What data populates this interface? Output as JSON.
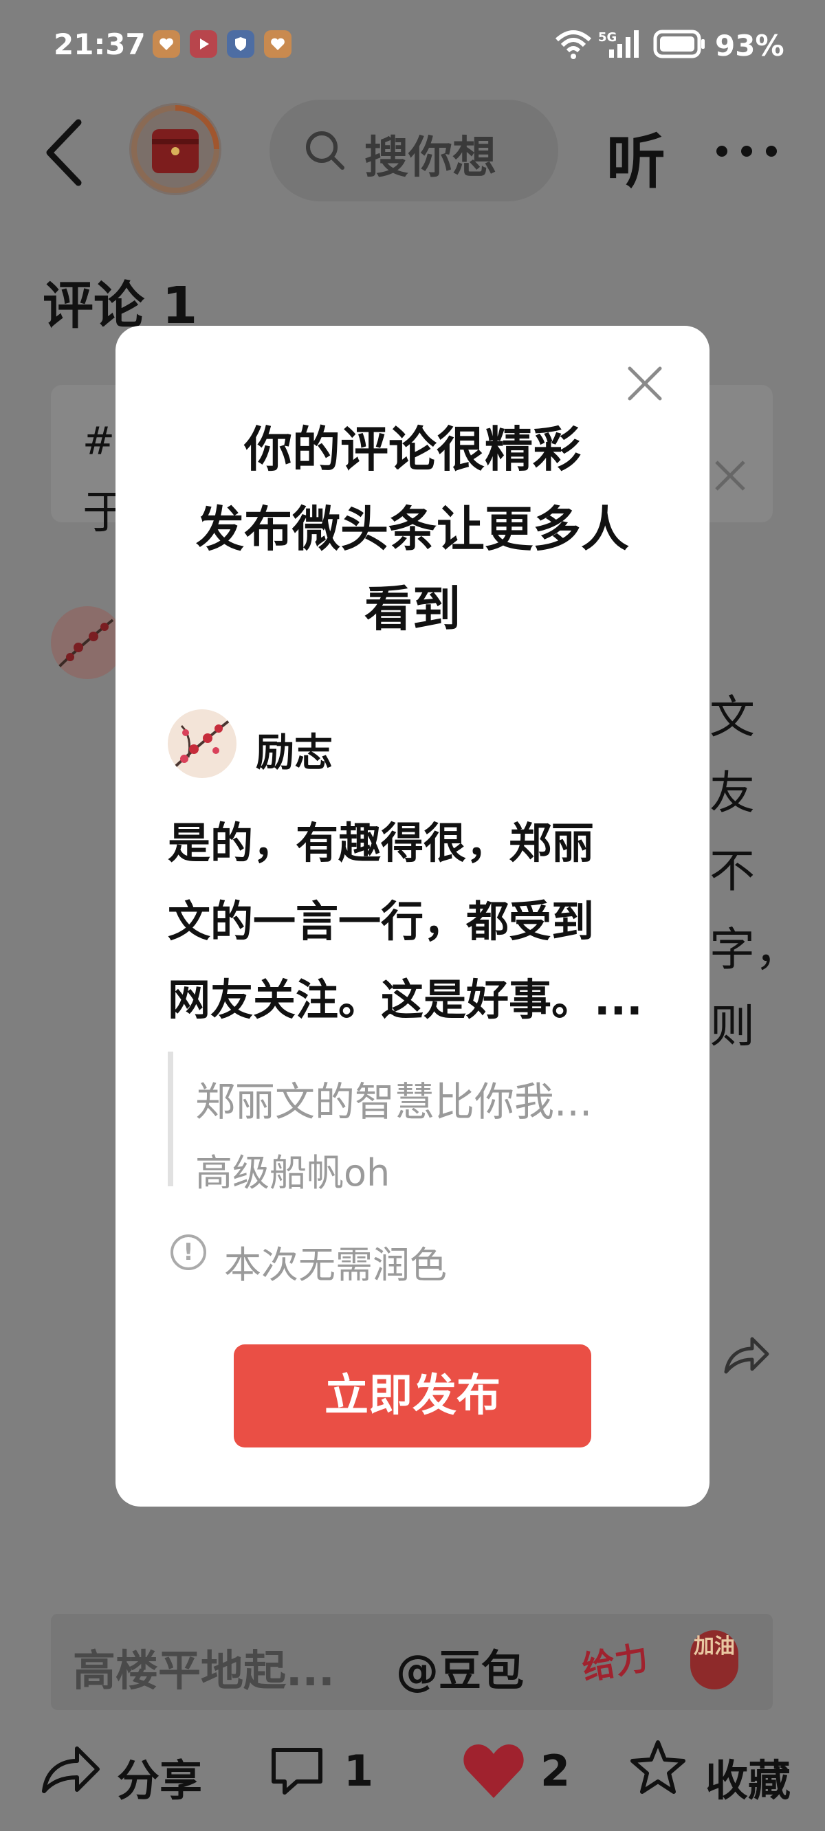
{
  "status_bar": {
    "time": "21:37",
    "network": "5G",
    "battery": "93%"
  },
  "nav": {
    "search_placeholder": "搜你想",
    "listen_label": "听"
  },
  "comments": {
    "title": "评论 1"
  },
  "banner": {
    "icon_text": "#",
    "text_start": "于"
  },
  "background_right_chars": [
    "文",
    "友",
    "不",
    "字，",
    "则"
  ],
  "modal": {
    "title_lines": [
      "你的评论很精彩",
      "发布微头条让更多人",
      "看到"
    ],
    "author": "励志",
    "comment_lines": [
      "是的，有趣得很，郑丽",
      "文的一言一行，都受到",
      "网友关注。这是好事。..."
    ],
    "quote_text": "郑丽文的智慧比你我...",
    "quote_author": "高级船帆oh",
    "polish_note": "本次无需润色",
    "publish_button": "立即发布"
  },
  "comment_input": {
    "placeholder": "高楼平地起...",
    "at_label": "@豆包",
    "sticker1": "给力",
    "sticker2": "加油"
  },
  "bottom_bar": {
    "share": "分享",
    "comment_count": "1",
    "like_count": "2",
    "favorite": "收藏"
  },
  "colors": {
    "accent": "#ea4f45",
    "overlay": "#7f7f7f",
    "heart": "#a0222e"
  }
}
